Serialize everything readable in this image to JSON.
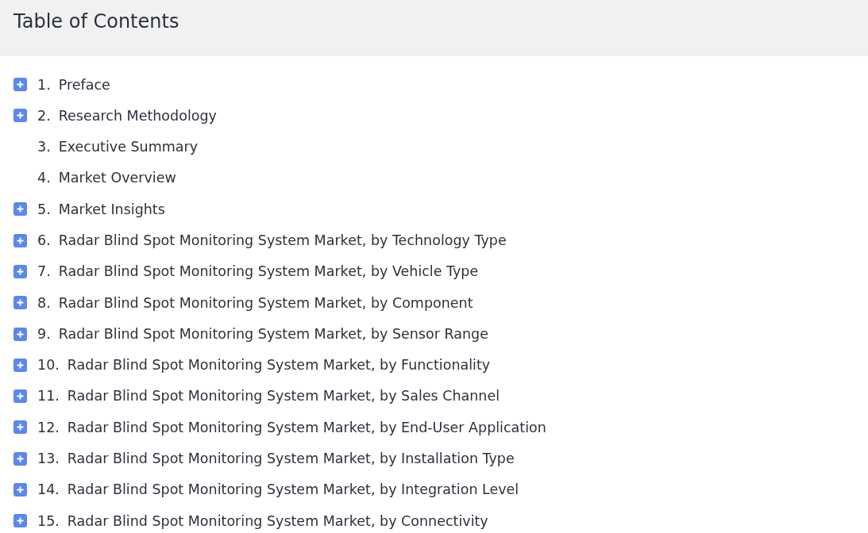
{
  "title": "Table of Contents",
  "items": [
    {
      "number": "1.",
      "label": "Preface",
      "kind": "expandable"
    },
    {
      "number": "2.",
      "label": "Research Methodology",
      "kind": "expandable"
    },
    {
      "number": "3.",
      "label": "Executive Summary",
      "kind": "leaf"
    },
    {
      "number": "4.",
      "label": "Market Overview",
      "kind": "leaf"
    },
    {
      "number": "5.",
      "label": "Market Insights",
      "kind": "expandable"
    },
    {
      "number": "6.",
      "label": "Radar Blind Spot Monitoring System Market, by Technology Type",
      "kind": "expandable"
    },
    {
      "number": "7.",
      "label": "Radar Blind Spot Monitoring System Market, by Vehicle Type",
      "kind": "expandable"
    },
    {
      "number": "8.",
      "label": "Radar Blind Spot Monitoring System Market, by Component",
      "kind": "expandable"
    },
    {
      "number": "9.",
      "label": "Radar Blind Spot Monitoring System Market, by Sensor Range",
      "kind": "expandable"
    },
    {
      "number": "10.",
      "label": "Radar Blind Spot Monitoring System Market, by Functionality",
      "kind": "expandable"
    },
    {
      "number": "11.",
      "label": "Radar Blind Spot Monitoring System Market, by Sales Channel",
      "kind": "expandable"
    },
    {
      "number": "12.",
      "label": "Radar Blind Spot Monitoring System Market, by End-User Application",
      "kind": "expandable"
    },
    {
      "number": "13.",
      "label": "Radar Blind Spot Monitoring System Market, by Installation Type",
      "kind": "expandable"
    },
    {
      "number": "14.",
      "label": "Radar Blind Spot Monitoring System Market, by Integration Level",
      "kind": "expandable"
    },
    {
      "number": "15.",
      "label": "Radar Blind Spot Monitoring System Market, by Connectivity",
      "kind": "expandable"
    }
  ]
}
